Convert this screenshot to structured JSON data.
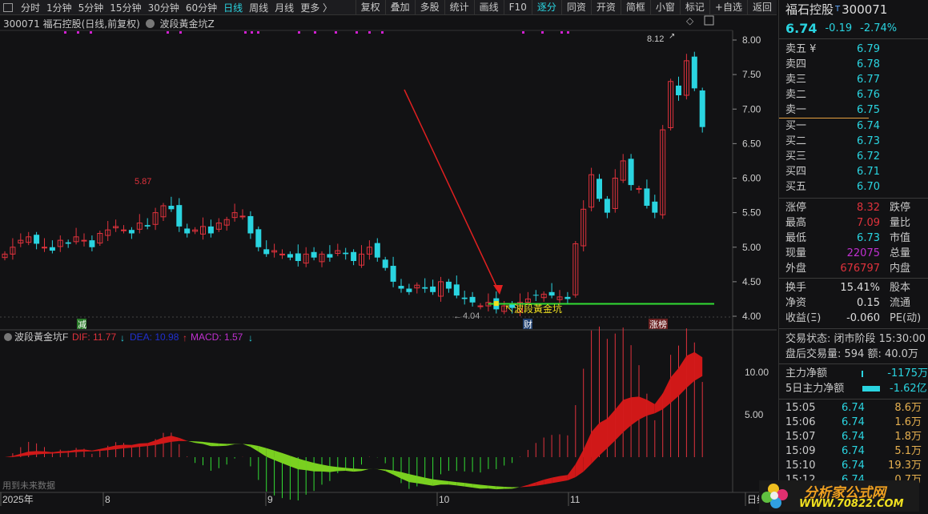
{
  "toolbar": {
    "periods": [
      "分时",
      "1分钟",
      "5分钟",
      "15分钟",
      "30分钟",
      "60分钟",
      "日线",
      "周线",
      "月线",
      "更多 〉"
    ],
    "active": "日线",
    "actions": [
      "复权",
      "叠加",
      "多股",
      "统计",
      "画线",
      "F10",
      "逐分",
      "同资",
      "开资",
      "简框",
      "小窗",
      "标记",
      "+自选",
      "返回"
    ],
    "active_action": "逐分"
  },
  "chart_title": {
    "code_name": "300071 福石控股(日线,前复权)",
    "indicator": "波段黃金坑Z"
  },
  "price_axis": [
    "8.00",
    "7.50",
    "7.00",
    "6.50",
    "6.00",
    "5.50",
    "5.00",
    "4.50",
    "4.00"
  ],
  "annotations": {
    "high": "8.12",
    "peak_aug": "5.87",
    "low": "4.04",
    "signal": "↖波段黃金坑",
    "tag_jian": "减",
    "tag_cai": "财",
    "tag_zhangbang": "涨榜"
  },
  "indicator_header": {
    "name": "波段黃金坑F",
    "dif": "DIF: 11.77",
    "dea": "DEA: 10.98",
    "macd": "MACD: 1.57"
  },
  "indicator_axis": [
    "10.00",
    "5.00"
  ],
  "future_note": "用到未来数据",
  "date_axis": [
    "2025年",
    "8",
    "9",
    "10",
    "11",
    "日线"
  ],
  "chart_data": {
    "type": "candlestick",
    "close": [
      4.9,
      5.0,
      5.1,
      5.15,
      5.05,
      5.0,
      4.95,
      5.1,
      5.05,
      5.15,
      5.1,
      5.0,
      5.2,
      5.25,
      5.3,
      5.25,
      5.2,
      5.35,
      5.3,
      5.5,
      5.6,
      5.55,
      5.3,
      5.2,
      5.25,
      5.3,
      5.2,
      5.35,
      5.4,
      5.5,
      5.45,
      5.2,
      5.0,
      4.9,
      4.95,
      4.9,
      4.85,
      4.8,
      4.9,
      4.85,
      4.9,
      4.85,
      4.95,
      4.9,
      4.8,
      4.9,
      5.0,
      4.85,
      4.7,
      4.5,
      4.4,
      4.35,
      4.45,
      4.4,
      4.35,
      4.5,
      4.4,
      4.3,
      4.25,
      4.2,
      4.15,
      4.2,
      4.1,
      4.15,
      4.12,
      4.2,
      4.25,
      4.3,
      4.32,
      4.3,
      4.28,
      4.25,
      5.05,
      5.55,
      6.05,
      5.7,
      5.5,
      6.0,
      6.25,
      5.9,
      5.85,
      5.6,
      5.5,
      6.7,
      7.4,
      7.2,
      7.7,
      7.3,
      6.74
    ],
    "signal_line": 4.18,
    "ylim": [
      4.0,
      8.0
    ]
  },
  "quote": {
    "name": "福石控股",
    "code": "300071",
    "price": "6.74",
    "change": "-0.19",
    "pct": "-2.74%",
    "asks": [
      {
        "l": "卖五 ¥",
        "p": "6.79"
      },
      {
        "l": "卖四",
        "p": "6.78"
      },
      {
        "l": "卖三",
        "p": "6.77"
      },
      {
        "l": "卖二",
        "p": "6.76"
      },
      {
        "l": "卖一",
        "p": "6.75"
      }
    ],
    "bids": [
      {
        "l": "买一",
        "p": "6.74"
      },
      {
        "l": "买二",
        "p": "6.73"
      },
      {
        "l": "买三",
        "p": "6.72"
      },
      {
        "l": "买四",
        "p": "6.71"
      },
      {
        "l": "买五",
        "p": "6.70"
      }
    ],
    "stats": [
      {
        "l": "涨停",
        "v": "8.32",
        "l2": "跌停"
      },
      {
        "l": "最高",
        "v": "7.09",
        "l2": "量比"
      },
      {
        "l": "最低",
        "v": "6.73",
        "l2": "市值"
      },
      {
        "l": "现量",
        "v": "22075",
        "l2": "总量"
      },
      {
        "l": "外盘",
        "v": "676797",
        "l2": "内盘"
      }
    ],
    "stats2": [
      {
        "l": "换手",
        "v": "15.41%",
        "l2": "股本"
      },
      {
        "l": "净资",
        "v": "0.15",
        "l2": "流通"
      },
      {
        "l": "收益(Ξ)",
        "v": "-0.060",
        "l2": "PE(动)"
      }
    ],
    "status": "交易状态: 闭市阶段 15:30:00",
    "after": "盘后交易量: 594  额: 40.0万",
    "main_net": {
      "l": "主力净额",
      "v": "-1175万"
    },
    "main_net5": {
      "l": "5日主力净额",
      "v": "-1.62亿"
    },
    "ticks": [
      {
        "t": "15:05",
        "p": "6.74",
        "v": "8.6万"
      },
      {
        "t": "15:06",
        "p": "6.74",
        "v": "1.6万"
      },
      {
        "t": "15:07",
        "p": "6.74",
        "v": "1.8万"
      },
      {
        "t": "15:09",
        "p": "6.74",
        "v": "5.1万"
      },
      {
        "t": "15:10",
        "p": "6.74",
        "v": "19.3万"
      },
      {
        "t": "15:12",
        "p": "6.74",
        "v": "0.7万"
      }
    ]
  },
  "logo": {
    "text": "分析家公式网",
    "url": "WWW.70822.COM"
  },
  "colors": {
    "up": "#e0323c",
    "down": "#2ad4e0",
    "signal": "#33dd33",
    "fill_up": "#d01818",
    "fill_down": "#7ad020"
  }
}
